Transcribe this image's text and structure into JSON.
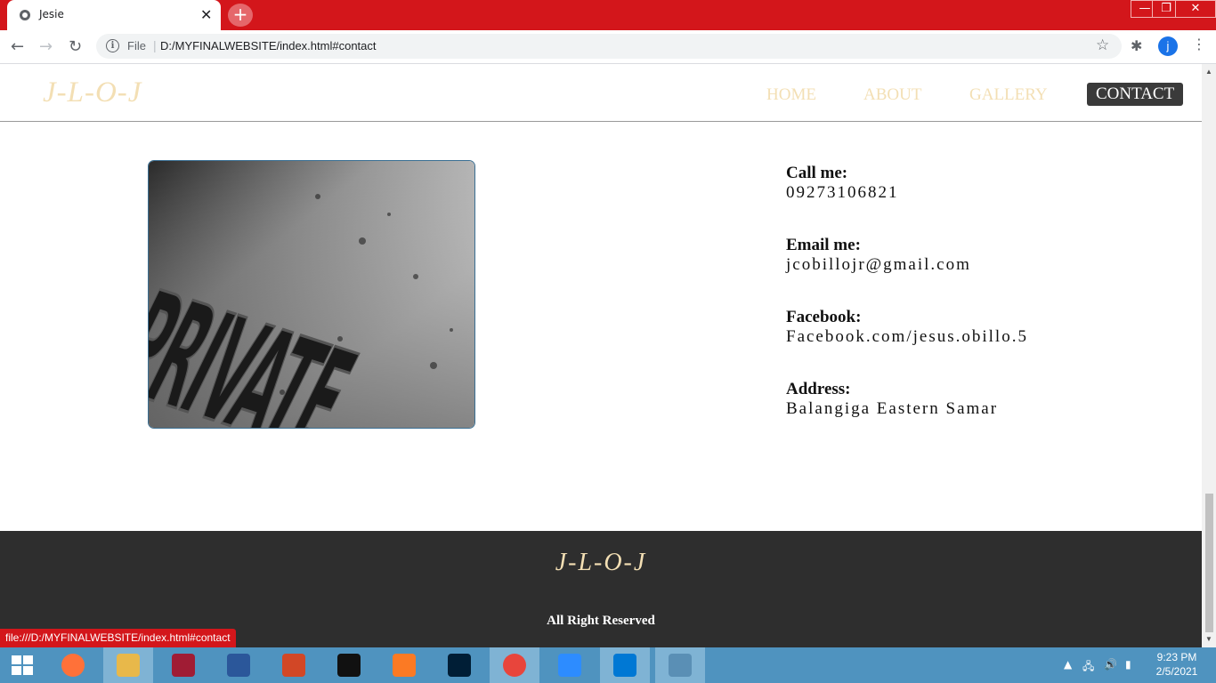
{
  "browser": {
    "tab_title": "Jesie",
    "tab_close": "✕",
    "new_tab": "+",
    "url_scheme": "File",
    "url": "D:/MYFINALWEBSITE/index.html#contact",
    "profile_initial": "j",
    "status_url": "file:///D:/MYFINALWEBSITE/index.html#contact",
    "window_controls": {
      "minimize": "—",
      "maximize": "❐",
      "close": "✕"
    }
  },
  "site": {
    "logo": "J-L-O-J",
    "nav": [
      {
        "label": "HOME",
        "active": false
      },
      {
        "label": "ABOUT",
        "active": false
      },
      {
        "label": "GALLERY",
        "active": false
      },
      {
        "label": "CONTACT",
        "active": true
      }
    ],
    "photo_text": "PRIVATE",
    "contact": [
      {
        "label": "Call me:",
        "value": "09273106821"
      },
      {
        "label": "Email me:",
        "value": "jcobillojr@gmail.com"
      },
      {
        "label": "Facebook:",
        "value": "Facebook.com/jesus.obillo.5"
      },
      {
        "label": "Address:",
        "value": "Balangiga Eastern Samar"
      }
    ],
    "footer": {
      "logo": "J-L-O-J",
      "rights": "All Right Reserved"
    }
  },
  "taskbar": {
    "apps": [
      {
        "name": "file-explorer-icon",
        "color": "#e8b84a"
      },
      {
        "name": "firefox-icon",
        "color": "#ff7139"
      },
      {
        "name": "mendeley-icon",
        "color": "#a01c34"
      },
      {
        "name": "word-icon",
        "color": "#2b579a"
      },
      {
        "name": "powerpoint-icon",
        "color": "#d24726"
      },
      {
        "name": "command-prompt-icon",
        "color": "#111111"
      },
      {
        "name": "xampp-icon",
        "color": "#fb7a24"
      },
      {
        "name": "photoshop-icon",
        "color": "#001e36"
      },
      {
        "name": "chrome-icon",
        "color": "#e8453c"
      },
      {
        "name": "zoom-icon",
        "color": "#2d8cff"
      },
      {
        "name": "vscode-icon",
        "color": "#0078d4"
      },
      {
        "name": "photos-icon",
        "color": "#5a8fb5"
      }
    ],
    "time": "9:23 PM",
    "date": "2/5/2021"
  },
  "colors": {
    "chrome_red": "#d3161b",
    "accent_gold": "#f3dfb4",
    "footer_bg": "#2e2e2e"
  }
}
